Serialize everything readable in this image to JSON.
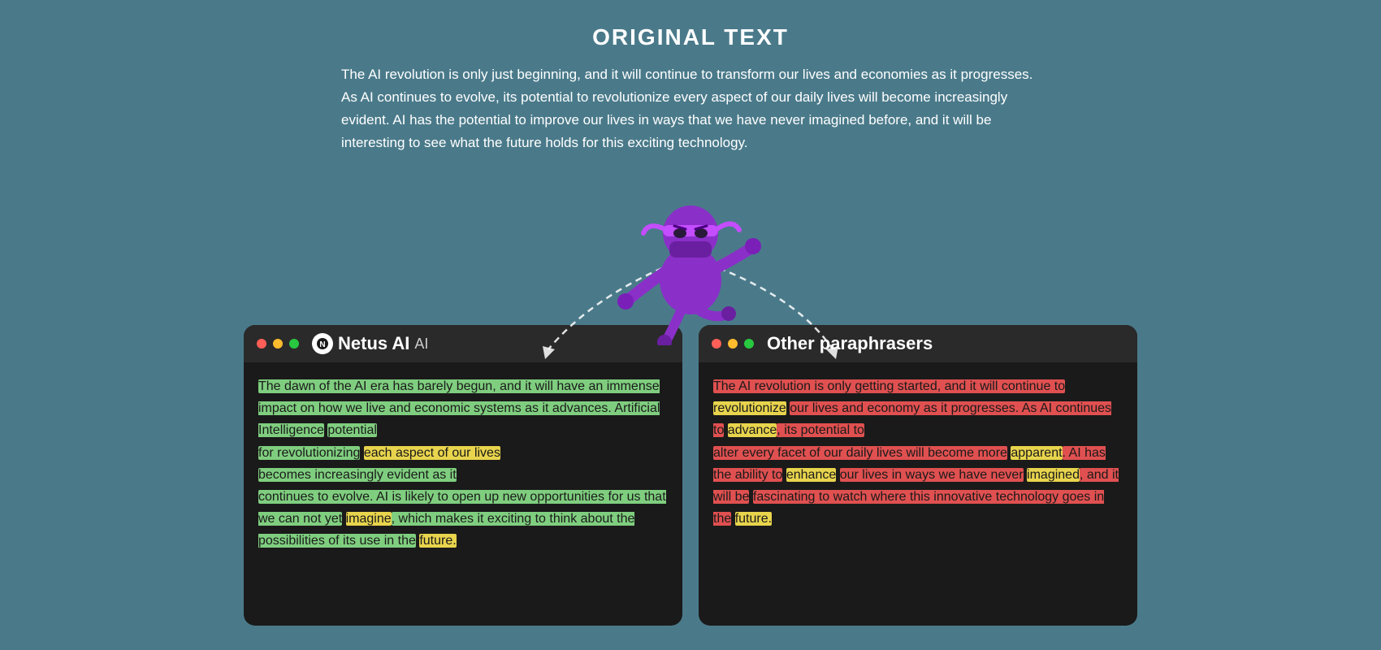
{
  "header": {
    "title": "ORIGINAL TEXT"
  },
  "original_text": "The AI revolution is only just beginning, and it will continue to transform our lives and economies as it progresses. As AI continues to evolve, its potential to revolutionize every aspect of our daily lives will become increasingly evident. AI has the potential to improve our lives in ways that we have never imagined before, and it will be interesting to see what the future holds for this exciting technology.",
  "netus_panel": {
    "title": "Netus AI",
    "logo": "N",
    "dots": [
      "red",
      "yellow",
      "green"
    ]
  },
  "other_panel": {
    "title": "Other paraphrasers",
    "dots": [
      "red",
      "yellow",
      "green"
    ]
  },
  "colors": {
    "background": "#4a7a8a",
    "panel_bg": "#1a1a1a",
    "titlebar_bg": "#2a2a2a"
  }
}
